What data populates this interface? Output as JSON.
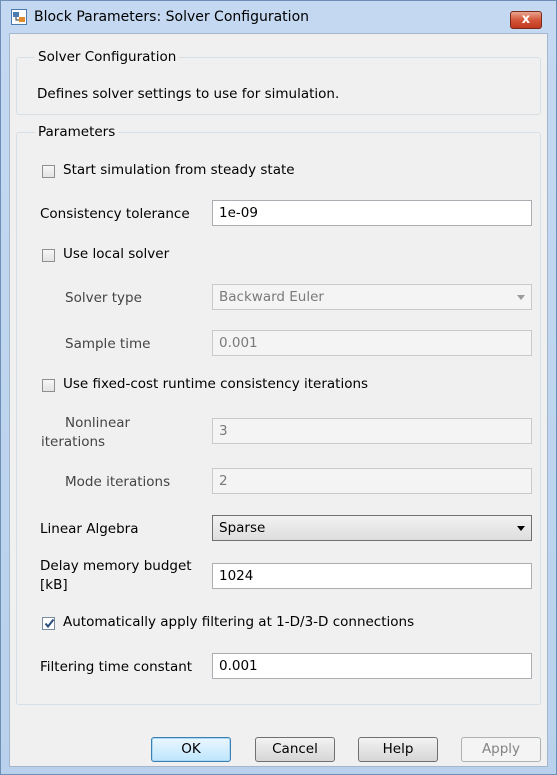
{
  "window": {
    "title": "Block Parameters: Solver Configuration",
    "close_label": "x"
  },
  "description_group": {
    "title": "Solver Configuration",
    "text": "Defines solver settings to use for simulation."
  },
  "parameters": {
    "title": "Parameters",
    "start_steady_state": {
      "label": "Start simulation from steady state",
      "checked": false
    },
    "consistency_tolerance": {
      "label": "Consistency tolerance",
      "value": "1e-09"
    },
    "use_local_solver": {
      "label": "Use local solver",
      "checked": false
    },
    "solver_type": {
      "label": "Solver type",
      "value": "Backward Euler"
    },
    "sample_time": {
      "label": "Sample time",
      "value": "0.001"
    },
    "fixed_cost": {
      "label": "Use fixed-cost runtime consistency iterations",
      "checked": false
    },
    "nonlinear_iterations": {
      "label_line1": "Nonlinear",
      "label_line2": "iterations",
      "value": "3"
    },
    "mode_iterations": {
      "label": "Mode iterations",
      "value": "2"
    },
    "linear_algebra": {
      "label": "Linear Algebra",
      "value": "Sparse"
    },
    "delay_memory": {
      "label_line1": "Delay memory budget",
      "label_line2": "[kB]",
      "value": "1024"
    },
    "auto_filter": {
      "label": "Automatically apply filtering at 1-D/3-D connections",
      "checked": true
    },
    "filter_time_constant": {
      "label": "Filtering time constant",
      "value": "0.001"
    }
  },
  "buttons": {
    "ok": "OK",
    "cancel": "Cancel",
    "help": "Help",
    "apply": "Apply"
  },
  "colors": {
    "accent": "#3c7fb1",
    "title_bar": "#c4d9f1",
    "close": "#c0391d"
  }
}
